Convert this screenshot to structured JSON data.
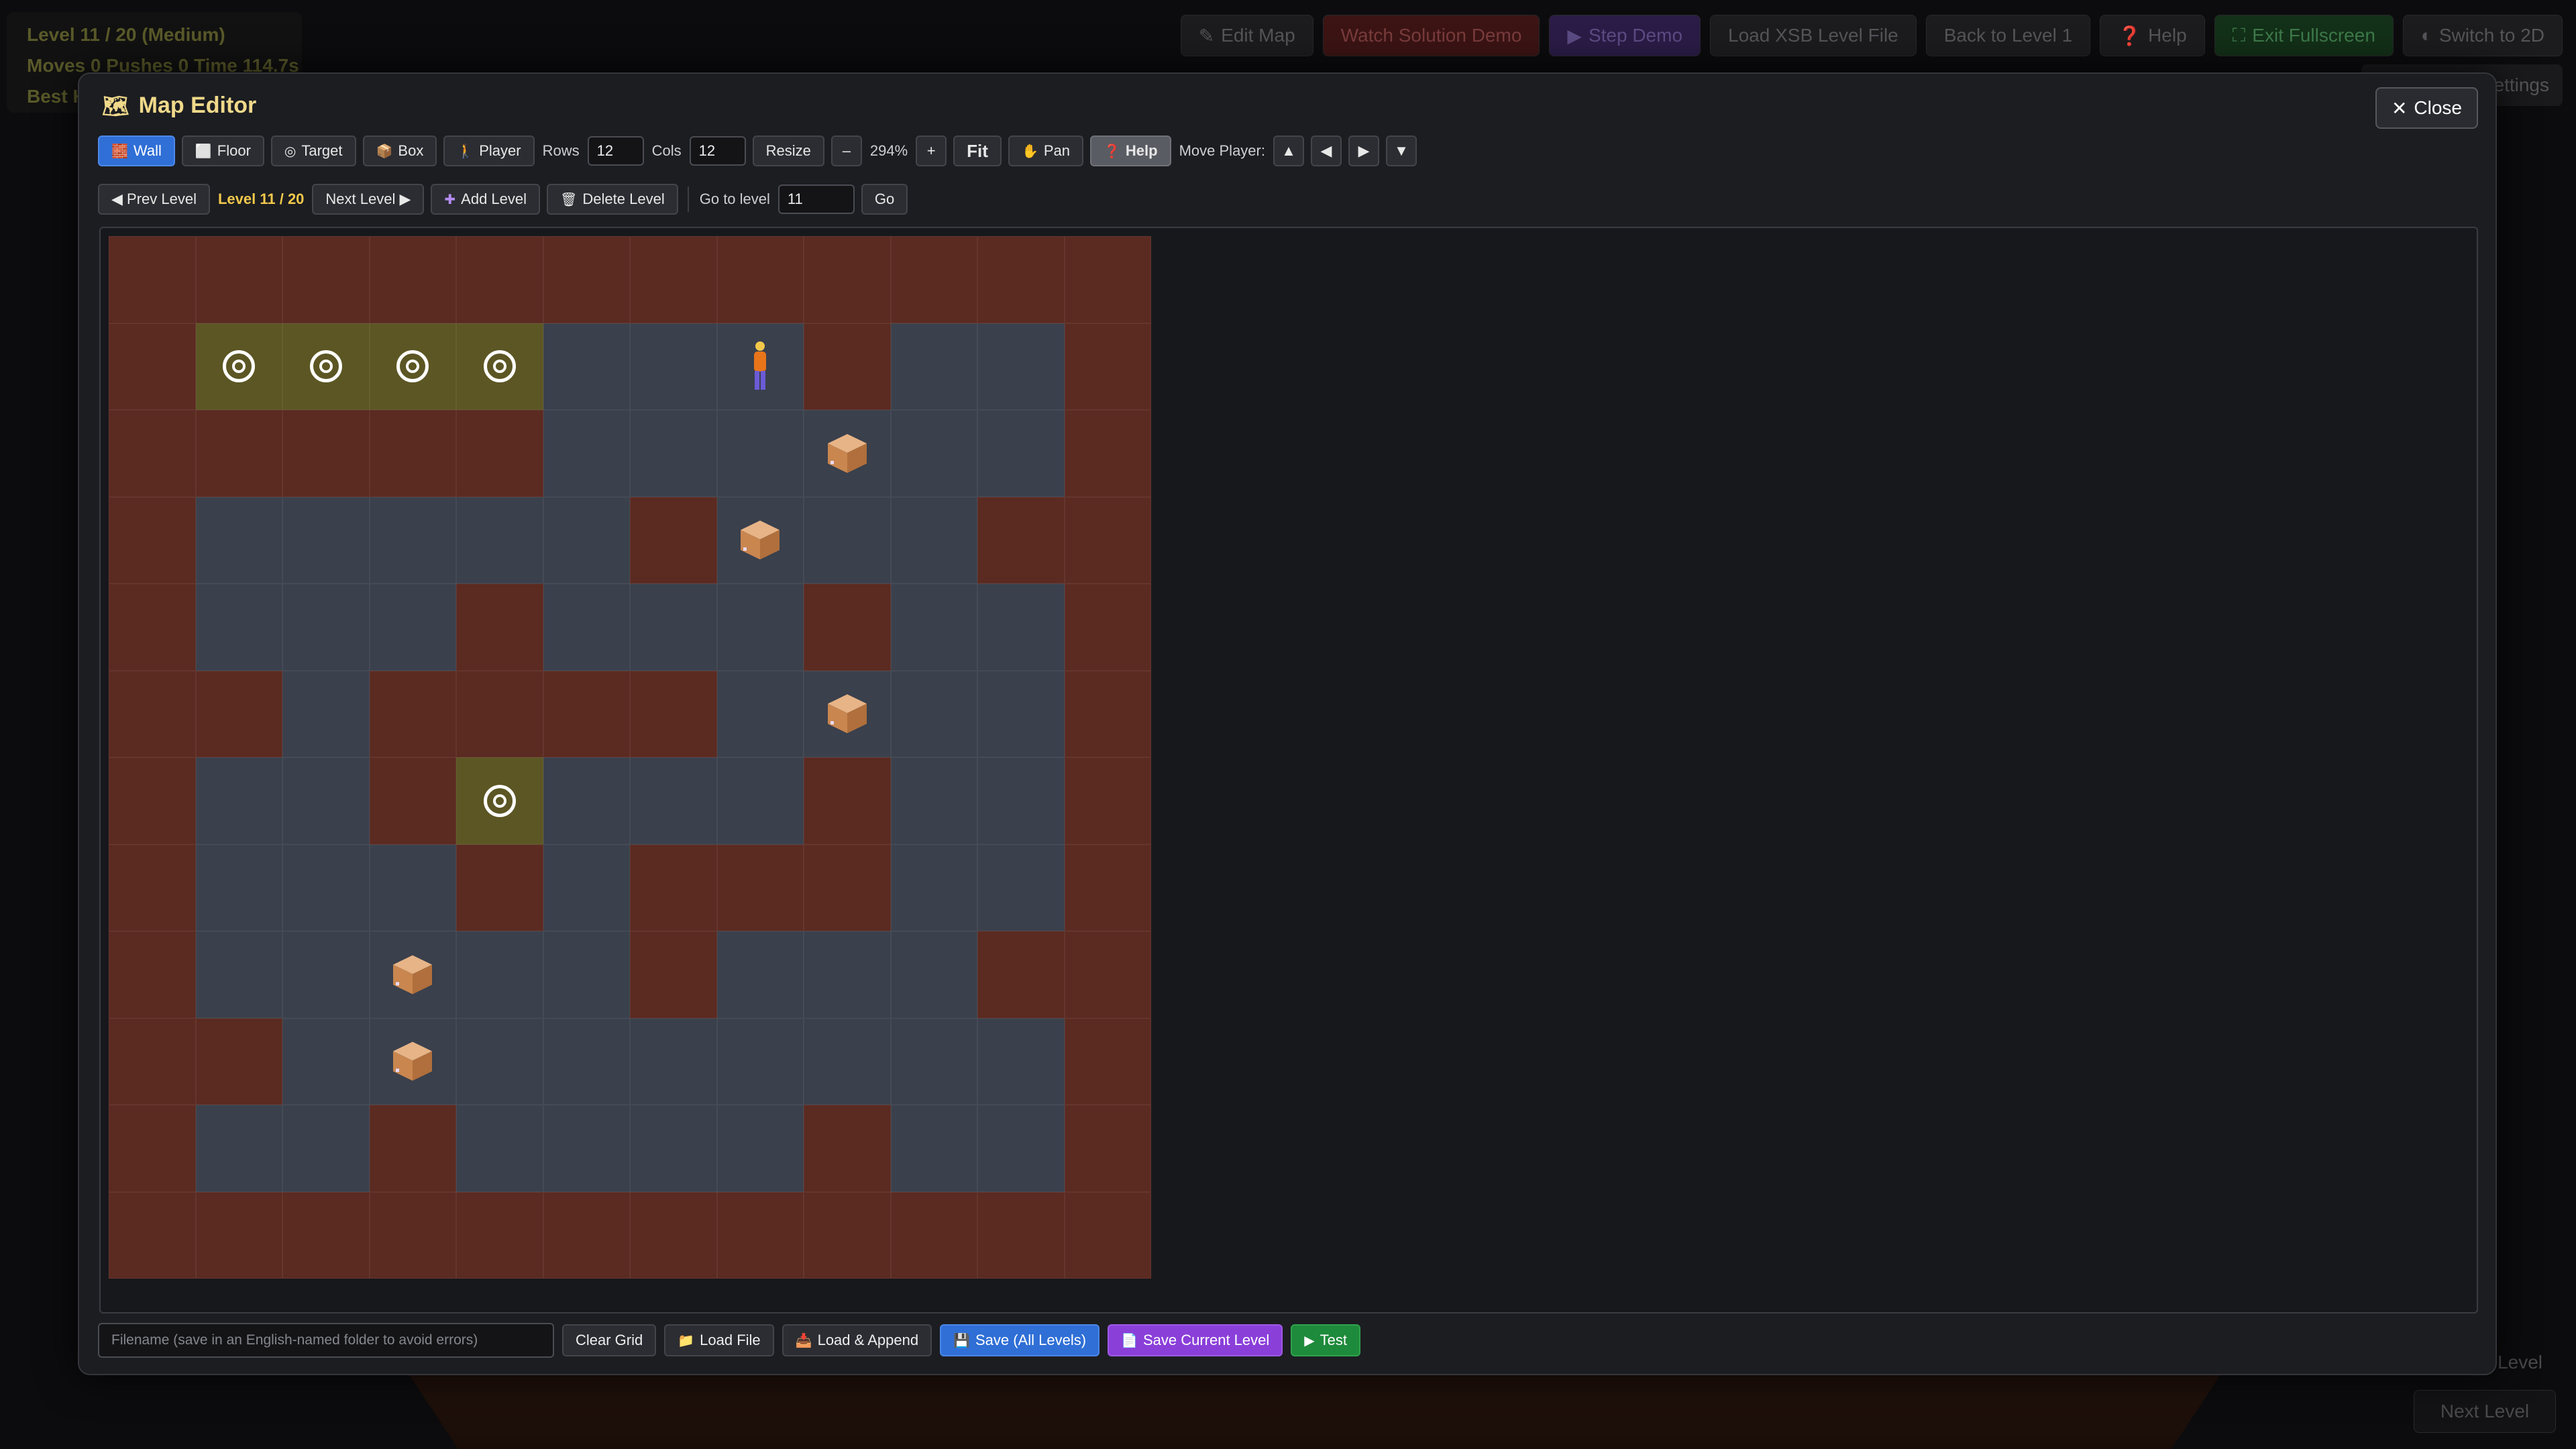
{
  "background": {
    "hud": {
      "level_line": "Level 11 / 20   (Medium)",
      "moves_line": "Moves 0 Pushes 0 Time 114.7s",
      "best_line": "Best K"
    },
    "topbar": [
      {
        "label": "Edit Map",
        "icon": "pencil-icon"
      },
      {
        "label": "Watch Solution Demo",
        "icon": ""
      },
      {
        "label": "Step Demo",
        "icon": "play-icon"
      },
      {
        "label": "Load XSB Level File",
        "icon": ""
      },
      {
        "label": "Back to Level 1",
        "icon": ""
      },
      {
        "label": "Help",
        "icon": "question-icon"
      },
      {
        "label": "Exit Fullscreen",
        "icon": "fullscreen-icon"
      },
      {
        "label": "Switch to 2D",
        "icon": "toggle-icon"
      }
    ],
    "settings_label": "ettings",
    "prev_label": "Level",
    "next_label": "Next Level"
  },
  "modal": {
    "title": "Map Editor",
    "close_label": "Close",
    "tools": {
      "wall": "Wall",
      "floor": "Floor",
      "target": "Target",
      "box": "Box",
      "player": "Player"
    },
    "rows_label": "Rows",
    "rows_value": "12",
    "cols_label": "Cols",
    "cols_value": "12",
    "resize_label": "Resize",
    "zoom_out": "–",
    "zoom_value": "294%",
    "zoom_in": "+",
    "fit_label": "Fit",
    "pan_label": "Pan",
    "help_label": "Help",
    "move_player_label": "Move Player:",
    "move_up": "▲",
    "move_left": "◀",
    "move_right": "▶",
    "move_down": "▼",
    "prev_level": "◀ Prev Level",
    "level_indicator": "Level 11 / 20",
    "next_level": "Next Level ▶",
    "add_level": "Add Level",
    "delete_level": "Delete Level",
    "goto_label": "Go to level",
    "goto_value": "11",
    "go_label": "Go",
    "active_tool": "wall"
  },
  "grid": {
    "rows": 12,
    "cols": 12,
    "legend": {
      "#": "wall",
      ".": "target",
      " ": "floor",
      "$": "box",
      "@": "player"
    },
    "map": [
      "############",
      "#....  @#  #",
      "#####   $  #",
      "#     #$  ##",
      "#   #   #  #",
      "## #### $  #",
      "#  #.   #  #",
      "#   # ###  #",
      "#  $  #   ##",
      "## $       #",
      "#  #    #  #",
      "############"
    ]
  },
  "bottom": {
    "filename_placeholder": "Filename (save in an English-named folder to avoid errors)",
    "clear_grid": "Clear Grid",
    "load_file": "Load File",
    "load_append": "Load & Append",
    "save_all": "Save (All Levels)",
    "save_current": "Save Current Level",
    "test": "Test"
  }
}
